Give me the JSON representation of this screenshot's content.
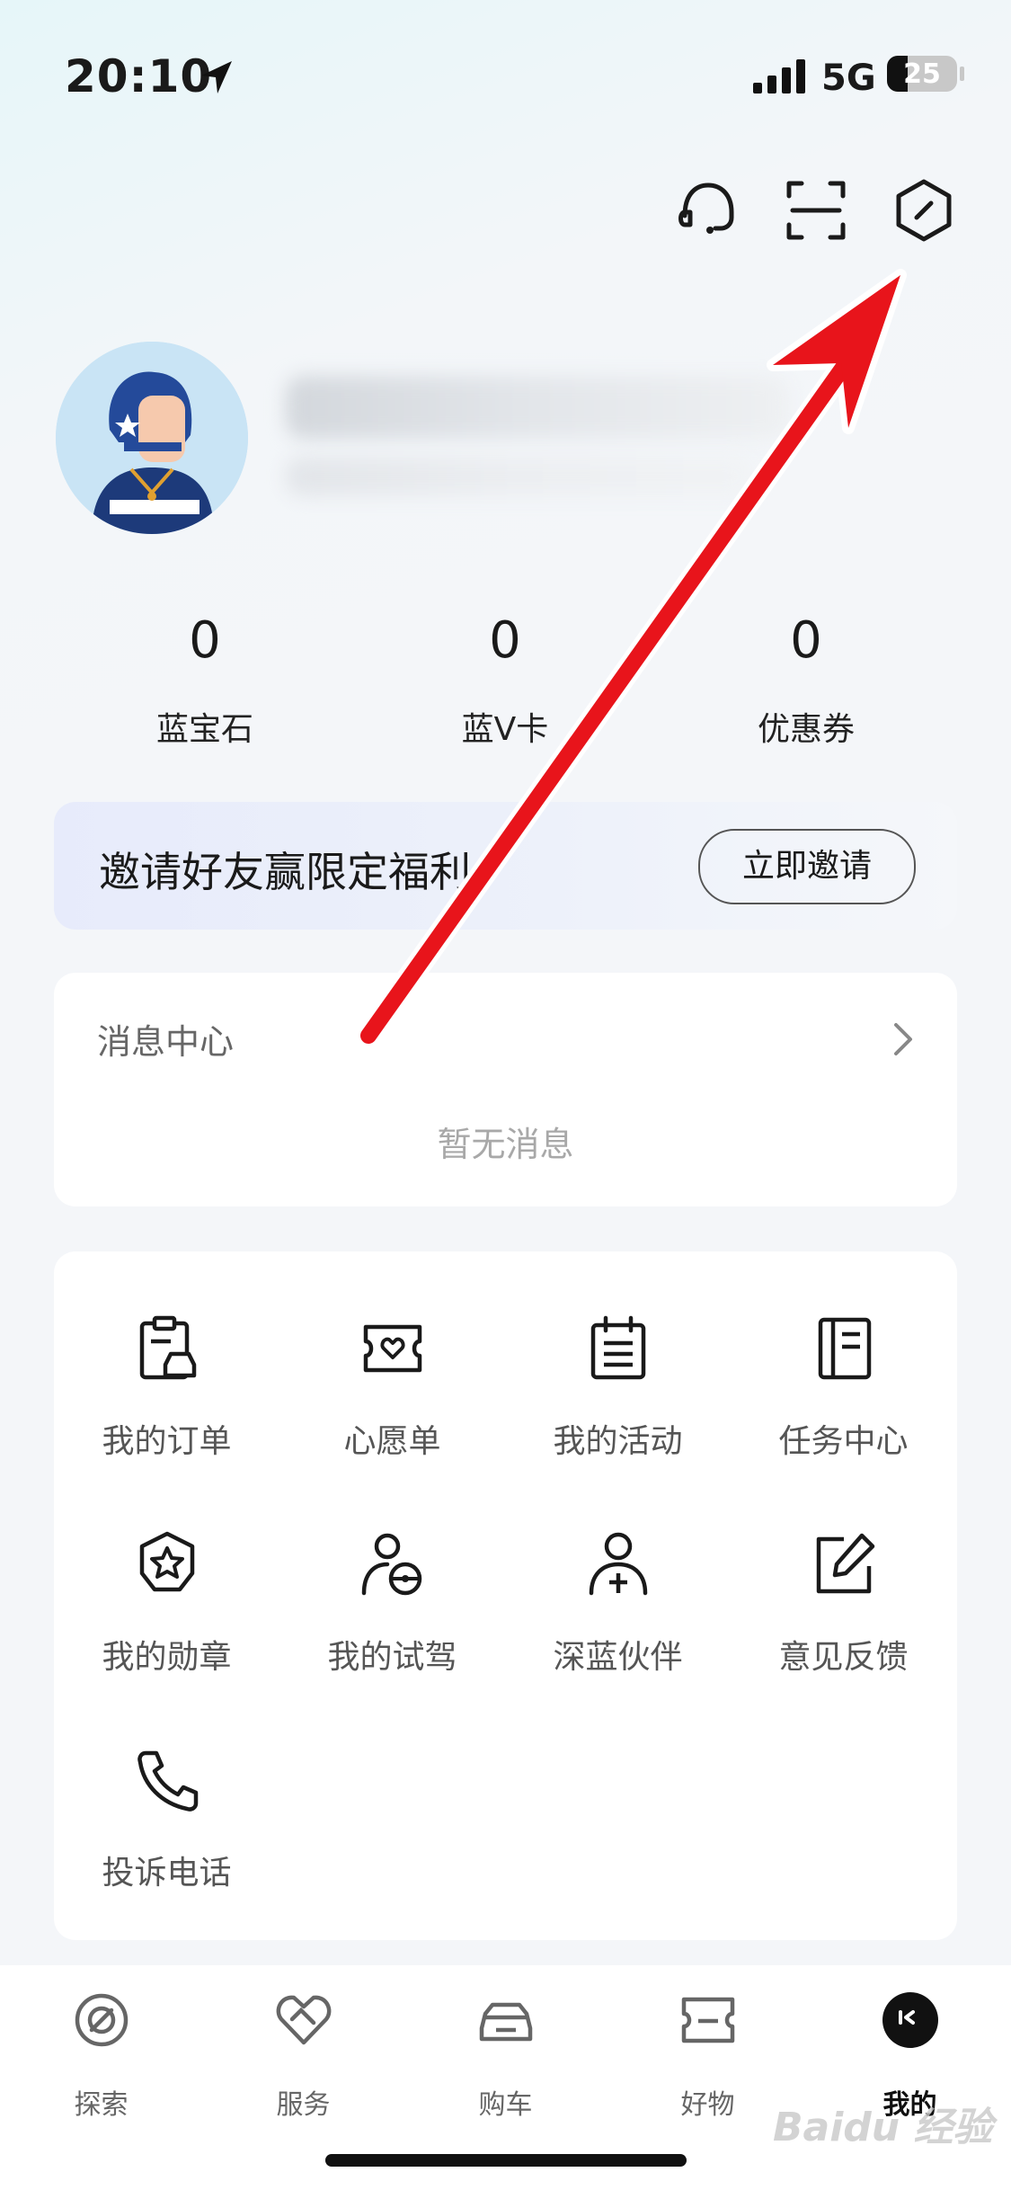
{
  "status_bar": {
    "time": "20:10",
    "network": "5G",
    "battery": "25"
  },
  "header_icons": [
    "headset-icon",
    "scan-icon",
    "settings-hexagon-icon"
  ],
  "stats": [
    {
      "value": "0",
      "label": "蓝宝石"
    },
    {
      "value": "0",
      "label": "蓝V卡"
    },
    {
      "value": "0",
      "label": "优惠券"
    }
  ],
  "invite": {
    "text": "邀请好友赢限定福利",
    "button": "立即邀请"
  },
  "message_center": {
    "title": "消息中心",
    "empty": "暂无消息"
  },
  "grid": {
    "items": [
      {
        "label": "我的订单",
        "icon": "order-icon"
      },
      {
        "label": "心愿单",
        "icon": "wishlist-icon"
      },
      {
        "label": "我的活动",
        "icon": "activity-icon"
      },
      {
        "label": "任务中心",
        "icon": "task-icon"
      },
      {
        "label": "我的勋章",
        "icon": "medal-icon"
      },
      {
        "label": "我的试驾",
        "icon": "test-drive-icon"
      },
      {
        "label": "深蓝伙伴",
        "icon": "partner-icon"
      },
      {
        "label": "意见反馈",
        "icon": "feedback-icon"
      },
      {
        "label": "投诉电话",
        "icon": "phone-icon"
      }
    ]
  },
  "tabs": [
    {
      "label": "探索",
      "icon": "explore-icon",
      "active": false
    },
    {
      "label": "服务",
      "icon": "service-icon",
      "active": false
    },
    {
      "label": "购车",
      "icon": "car-icon",
      "active": false
    },
    {
      "label": "好物",
      "icon": "goods-icon",
      "active": false
    },
    {
      "label": "我的",
      "icon": "profile-icon",
      "active": true
    }
  ],
  "watermark": "Baidu 经验",
  "colors": {
    "accent_arrow": "#e8141b",
    "background": "#f4f6f9",
    "card": "#ffffff"
  }
}
